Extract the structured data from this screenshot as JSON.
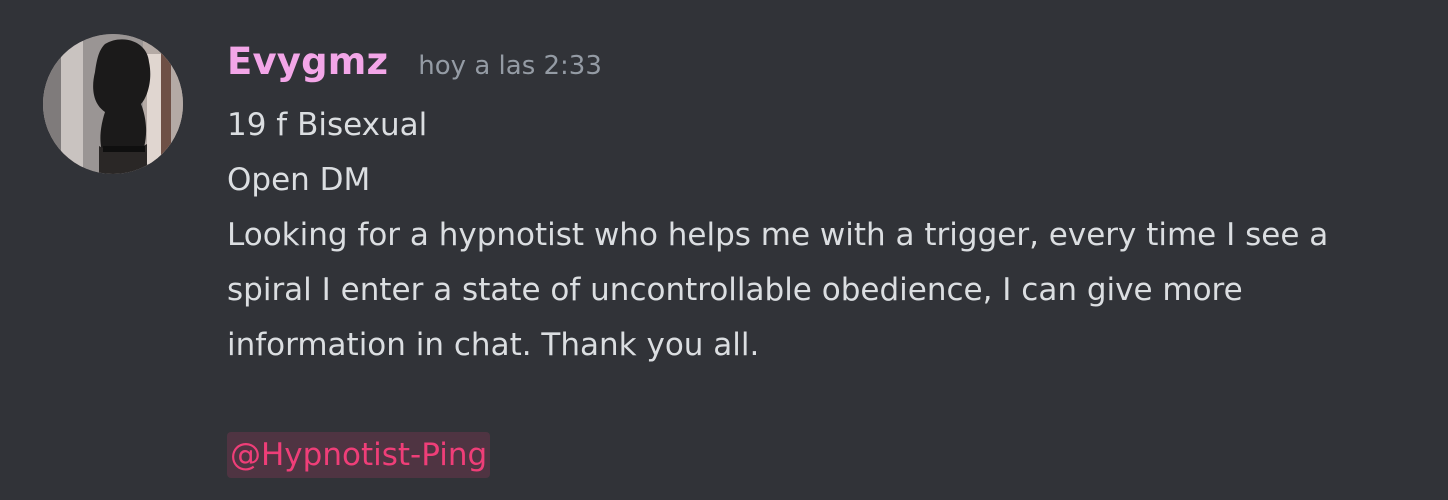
{
  "message": {
    "author": {
      "username": "Evygmz",
      "avatar_alt": "user-avatar-photo"
    },
    "timestamp": "hoy a las 2:33",
    "lines": [
      "19 f Bisexual",
      "Open DM"
    ],
    "paragraph": "Looking for a hypnotist who helps me with a trigger, every time I see a spiral I enter a state of uncontrollable obedience, I can give more information in chat. Thank you all.",
    "mention": "@Hypnotist-Ping"
  },
  "colors": {
    "background": "#313338",
    "username": "#f3a6e8",
    "timestamp": "#949ba4",
    "text": "#dbdee1",
    "mention": "#ef3e78"
  }
}
